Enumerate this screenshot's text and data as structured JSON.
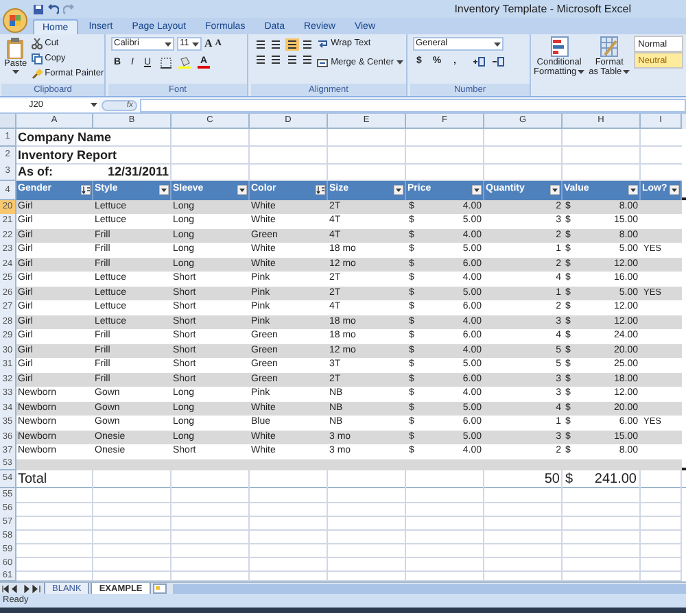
{
  "window": {
    "title": "Inventory Template - Microsoft Excel"
  },
  "ribbon_tabs": [
    {
      "label": "Home",
      "selected": true
    },
    {
      "label": "Insert",
      "selected": false
    },
    {
      "label": "Page Layout",
      "selected": false
    },
    {
      "label": "Formulas",
      "selected": false
    },
    {
      "label": "Data",
      "selected": false
    },
    {
      "label": "Review",
      "selected": false
    },
    {
      "label": "View",
      "selected": false
    }
  ],
  "ribbon": {
    "clipboard": {
      "label": "Clipboard",
      "paste": "Paste",
      "items": [
        "Cut",
        "Copy",
        "Format Painter"
      ]
    },
    "font": {
      "label": "Font",
      "name": "Calibri",
      "size": "11",
      "grow": "A",
      "shrink": "A",
      "styles": [
        "B",
        "I",
        "U"
      ],
      "color_button": "A"
    },
    "alignment": {
      "label": "Alignment",
      "wrap": "Wrap Text",
      "merge": "Merge & Center"
    },
    "number": {
      "label": "Number",
      "format": "General",
      "buttons": [
        "$",
        "%",
        ","
      ]
    },
    "styles": {
      "conditional": [
        "Conditional",
        "Formatting"
      ],
      "format_table": [
        "Format",
        "as Table"
      ],
      "cell_styles": [
        {
          "label": "Normal",
          "color": "#ffffff"
        },
        {
          "label": "Neutral",
          "color": "#ffeb9c"
        }
      ]
    }
  },
  "formula_bar": {
    "name_box": "J20",
    "function_label": "fx"
  },
  "columns": [
    "A",
    "B",
    "C",
    "D",
    "E",
    "F",
    "G",
    "H",
    "I"
  ],
  "title_rows": [
    {
      "number": "1",
      "text": "Company Name"
    },
    {
      "number": "2",
      "text": "Inventory Report"
    },
    {
      "number": "3",
      "text": "As of:",
      "date": "12/31/2011"
    }
  ],
  "table": {
    "row_number": "4",
    "headers": [
      {
        "label": "Gender",
        "sorted": true
      },
      {
        "label": "Style",
        "sorted": false
      },
      {
        "label": "Sleeve",
        "sorted": false
      },
      {
        "label": "Color",
        "sorted": true
      },
      {
        "label": "Size",
        "sorted": false
      },
      {
        "label": "Price",
        "sorted": false
      },
      {
        "label": "Quantity",
        "sorted": false
      },
      {
        "label": "Value",
        "sorted": false
      },
      {
        "label": "Low?",
        "sorted": false
      }
    ],
    "rows": [
      {
        "number": "20",
        "selected": true,
        "cells": [
          "Girl",
          "Lettuce",
          "Long",
          "White",
          "2T"
        ],
        "price": [
          "$",
          "4.00"
        ],
        "quantity": "2",
        "value": [
          "$",
          "8.00"
        ]
      },
      {
        "number": "21",
        "selected": false,
        "cells": [
          "Girl",
          "Lettuce",
          "Long",
          "White",
          "4T"
        ],
        "price": [
          "$",
          "5.00"
        ],
        "quantity": "3",
        "value": [
          "$",
          "15.00"
        ]
      },
      {
        "number": "22",
        "selected": false,
        "cells": [
          "Girl",
          "Frill",
          "Long",
          "Green",
          "4T"
        ],
        "price": [
          "$",
          "4.00"
        ],
        "quantity": "2",
        "value": [
          "$",
          "8.00"
        ]
      },
      {
        "number": "23",
        "selected": false,
        "cells": [
          "Girl",
          "Frill",
          "Long",
          "White",
          "18 mo"
        ],
        "price": [
          "$",
          "5.00"
        ],
        "quantity": "1",
        "value": [
          "$",
          "5.00"
        ],
        "low": "YES"
      },
      {
        "number": "24",
        "selected": false,
        "cells": [
          "Girl",
          "Frill",
          "Long",
          "White",
          "12 mo"
        ],
        "price": [
          "$",
          "6.00"
        ],
        "quantity": "2",
        "value": [
          "$",
          "12.00"
        ]
      },
      {
        "number": "25",
        "selected": false,
        "cells": [
          "Girl",
          "Lettuce",
          "Short",
          "Pink",
          "2T"
        ],
        "price": [
          "$",
          "4.00"
        ],
        "quantity": "4",
        "value": [
          "$",
          "16.00"
        ]
      },
      {
        "number": "26",
        "selected": false,
        "cells": [
          "Girl",
          "Lettuce",
          "Short",
          "Pink",
          "2T"
        ],
        "price": [
          "$",
          "5.00"
        ],
        "quantity": "1",
        "value": [
          "$",
          "5.00"
        ],
        "low": "YES"
      },
      {
        "number": "27",
        "selected": false,
        "cells": [
          "Girl",
          "Lettuce",
          "Short",
          "Pink",
          "4T"
        ],
        "price": [
          "$",
          "6.00"
        ],
        "quantity": "2",
        "value": [
          "$",
          "12.00"
        ]
      },
      {
        "number": "28",
        "selected": false,
        "cells": [
          "Girl",
          "Lettuce",
          "Short",
          "Pink",
          "18 mo"
        ],
        "price": [
          "$",
          "4.00"
        ],
        "quantity": "3",
        "value": [
          "$",
          "12.00"
        ]
      },
      {
        "number": "29",
        "selected": false,
        "cells": [
          "Girl",
          "Frill",
          "Short",
          "Green",
          "18 mo"
        ],
        "price": [
          "$",
          "6.00"
        ],
        "quantity": "4",
        "value": [
          "$",
          "24.00"
        ]
      },
      {
        "number": "30",
        "selected": false,
        "cells": [
          "Girl",
          "Frill",
          "Short",
          "Green",
          "12 mo"
        ],
        "price": [
          "$",
          "4.00"
        ],
        "quantity": "5",
        "value": [
          "$",
          "20.00"
        ]
      },
      {
        "number": "31",
        "selected": false,
        "cells": [
          "Girl",
          "Frill",
          "Short",
          "Green",
          "3T"
        ],
        "price": [
          "$",
          "5.00"
        ],
        "quantity": "5",
        "value": [
          "$",
          "25.00"
        ]
      },
      {
        "number": "32",
        "selected": false,
        "cells": [
          "Girl",
          "Frill",
          "Short",
          "Green",
          "2T"
        ],
        "price": [
          "$",
          "6.00"
        ],
        "quantity": "3",
        "value": [
          "$",
          "18.00"
        ]
      },
      {
        "number": "33",
        "selected": false,
        "cells": [
          "Newborn",
          "Gown",
          "Long",
          "Pink",
          "NB"
        ],
        "price": [
          "$",
          "4.00"
        ],
        "quantity": "3",
        "value": [
          "$",
          "12.00"
        ]
      },
      {
        "number": "34",
        "selected": false,
        "cells": [
          "Newborn",
          "Gown",
          "Long",
          "White",
          "NB"
        ],
        "price": [
          "$",
          "5.00"
        ],
        "quantity": "4",
        "value": [
          "$",
          "20.00"
        ]
      },
      {
        "number": "35",
        "selected": false,
        "cells": [
          "Newborn",
          "Gown",
          "Long",
          "Blue",
          "NB"
        ],
        "price": [
          "$",
          "6.00"
        ],
        "quantity": "1",
        "value": [
          "$",
          "6.00"
        ],
        "low": "YES"
      },
      {
        "number": "36",
        "selected": false,
        "cells": [
          "Newborn",
          "Onesie",
          "Long",
          "White",
          "3 mo"
        ],
        "price": [
          "$",
          "5.00"
        ],
        "quantity": "3",
        "value": [
          "$",
          "15.00"
        ]
      },
      {
        "number": "37",
        "selected": false,
        "cells": [
          "Newborn",
          "Onesie",
          "Short",
          "White",
          "3 mo"
        ],
        "price": [
          "$",
          "4.00"
        ],
        "quantity": "2",
        "value": [
          "$",
          "8.00"
        ]
      }
    ],
    "spacer_row": "53",
    "total": {
      "number": "54",
      "label": "Total",
      "quantity": "50",
      "value": [
        "$",
        "241.00"
      ]
    }
  },
  "empty_rows": [
    "55",
    "56",
    "57",
    "58",
    "59",
    "60",
    "61"
  ],
  "sheet_tabs": [
    {
      "label": "BLANK",
      "selected": false
    },
    {
      "label": "EXAMPLE",
      "selected": true
    }
  ],
  "status_bar": {
    "text": "Ready"
  }
}
